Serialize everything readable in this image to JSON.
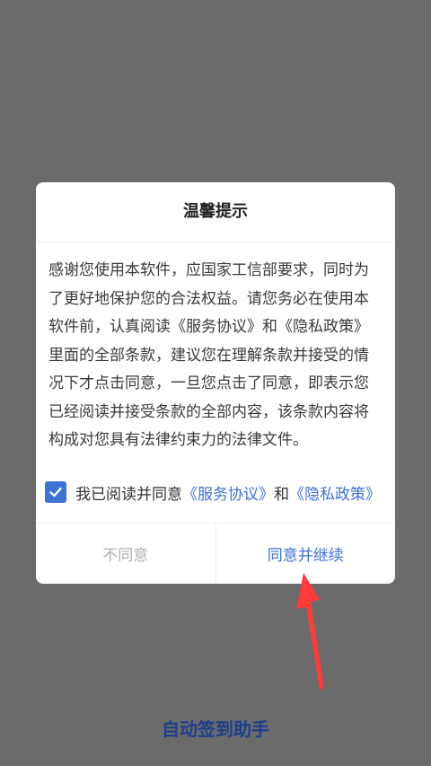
{
  "dialog": {
    "title": "温馨提示",
    "body": "感谢您使用本软件，应国家工信部要求，同时为了更好地保护您的合法权益。请您务必在使用本软件前，认真阅读《服务协议》和《隐私政策》里面的全部条款，建议您在理解条款并接受的情况下才点击同意，一旦您点击了同意，即表示您已经阅读并接受条款的全部内容，该条款内容将构成对您具有法律约束力的法律文件。",
    "agree_prefix": "我已阅读并同意",
    "service_link": "《服务协议》",
    "and_text": "和",
    "privacy_link": "《隐私政策》",
    "checkbox_checked": true,
    "disagree_label": "不同意",
    "agree_label": "同意并继续"
  },
  "app": {
    "name": "自动签到助手"
  },
  "colors": {
    "accent": "#3d72d6",
    "arrow": "#ff3b3b",
    "overlay": "#6b6b6b"
  }
}
